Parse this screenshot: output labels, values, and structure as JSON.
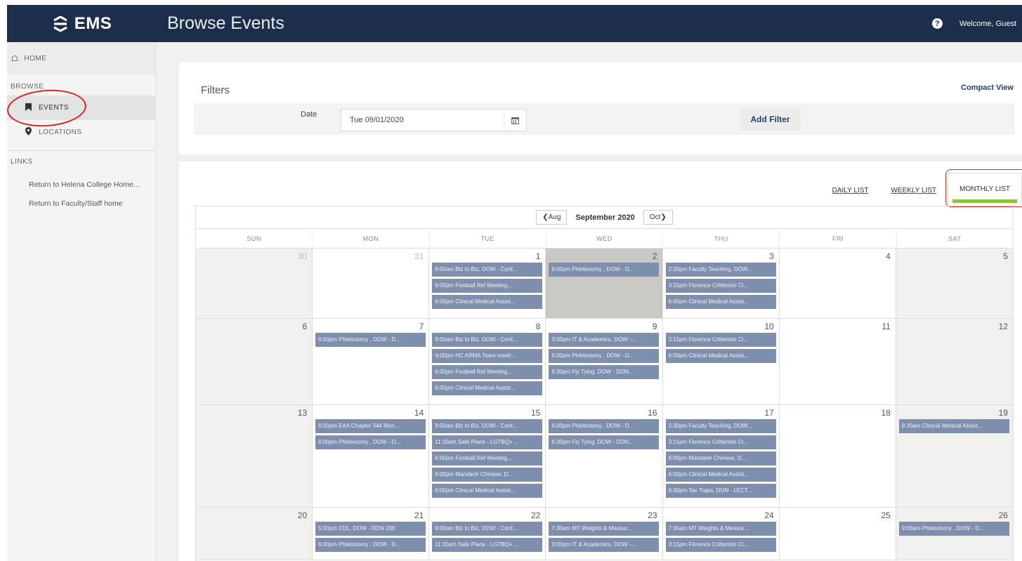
{
  "app": {
    "brand": "EMS",
    "page_title": "Browse Events",
    "help": "?",
    "welcome": "Welcome, Guest"
  },
  "sidebar": {
    "home": "HOME",
    "browse_label": "BROWSE",
    "items": [
      {
        "label": "EVENTS",
        "icon": "bookmark-icon"
      },
      {
        "label": "LOCATIONS",
        "icon": "map-pin-icon"
      }
    ],
    "links_label": "LINKS",
    "links": [
      "Return to Helena College Home...",
      "Return to Faculty/Staff home"
    ]
  },
  "filters": {
    "title": "Filters",
    "compact_view": "Compact View",
    "date_label": "Date",
    "date_value": "Tue 09/01/2020",
    "add_filter": "Add Filter"
  },
  "views": {
    "daily": "DAILY LIST",
    "weekly": "WEEKLY LIST",
    "monthly": "MONTHLY LIST"
  },
  "calendar": {
    "prev": "Aug",
    "next": "Oct",
    "title": "September 2020",
    "dow": [
      "SUN",
      "MON",
      "TUE",
      "WED",
      "THU",
      "FRI",
      "SAT"
    ],
    "weeks": [
      [
        {
          "day": "30",
          "out": true,
          "events": []
        },
        {
          "day": "31",
          "out": true,
          "events": []
        },
        {
          "day": "1",
          "events": [
            "9:00am Biz to Biz, DOW - Conf...",
            "6:00pm Football Ref Meeting,...",
            "6:00pm Clinical Medical Assist..."
          ]
        },
        {
          "day": "2",
          "today": true,
          "events": [
            "6:00pm Phlebotomy , DOW - D..."
          ]
        },
        {
          "day": "3",
          "events": [
            "2:30pm Faculty Teaching, DOW...",
            "3:15pm Florence Crittenton Cl...",
            "6:00pm Clinical Medical Assist..."
          ]
        },
        {
          "day": "4",
          "events": []
        },
        {
          "day": "5",
          "events": []
        }
      ],
      [
        {
          "day": "6",
          "events": []
        },
        {
          "day": "7",
          "events": [
            "6:00pm Phlebotomy , DOW - D..."
          ]
        },
        {
          "day": "8",
          "events": [
            "9:00am Biz to Biz, DOW - Conf...",
            "4:00pm HC ARMA Team meeti...",
            "6:00pm Football Ref Meeting,...",
            "6:00pm Clinical Medical Assist..."
          ]
        },
        {
          "day": "9",
          "events": [
            "3:00pm IT & Academics, DOW -...",
            "6:00pm Phlebotomy , DOW - D...",
            "6:30pm Fly Tying, DOW - DON..."
          ]
        },
        {
          "day": "10",
          "events": [
            "3:15pm Florence Crittenton Cl...",
            "6:00pm Clinical Medical Assist..."
          ]
        },
        {
          "day": "11",
          "events": []
        },
        {
          "day": "12",
          "events": []
        }
      ],
      [
        {
          "day": "13",
          "events": []
        },
        {
          "day": "14",
          "events": [
            "6:00pm EAA Chapter 344 Mon...",
            "6:00pm Phlebotomy , DOW - D..."
          ]
        },
        {
          "day": "15",
          "events": [
            "9:00am Biz to Biz, DOW - Conf...",
            "11:30am Safe Place - LGTBQ+ ...",
            "6:00pm Football Ref Meeting,...",
            "6:00pm Mandarin Chinese, D...",
            "6:00pm Clinical Medical Assist..."
          ]
        },
        {
          "day": "16",
          "events": [
            "6:00pm Phlebotomy , DOW - D...",
            "6:30pm Fly Tying, DOW - DON..."
          ]
        },
        {
          "day": "17",
          "events": [
            "2:30pm Faculty Teaching, DOW...",
            "3:15pm Florence Crittenton Cl...",
            "6:00pm Mandarin Chinese, D...",
            "6:00pm Clinical Medical Assist...",
            "6:30pm Tax Traps, DON - LECT..."
          ]
        },
        {
          "day": "18",
          "events": []
        },
        {
          "day": "19",
          "events": [
            "8:30am Clinical Medical Assist..."
          ]
        }
      ],
      [
        {
          "day": "20",
          "events": []
        },
        {
          "day": "21",
          "events": [
            "5:00pm CDL, DOW - DON 206",
            "6:00pm Phlebotomy , DOW - D..."
          ]
        },
        {
          "day": "22",
          "events": [
            "9:00am Biz to Biz, DOW - Conf...",
            "11:30am Safe Place - LGTBQ+ ..."
          ]
        },
        {
          "day": "23",
          "events": [
            "7:30am MT Weights & Measur...",
            "3:00pm IT & Academics, DOW -..."
          ]
        },
        {
          "day": "24",
          "events": [
            "7:30am MT Weights & Measur...",
            "3:15pm Florence Crittenton Cl..."
          ]
        },
        {
          "day": "25",
          "events": []
        },
        {
          "day": "26",
          "events": [
            "9:00am Phlebotomy , DOW - D..."
          ]
        }
      ]
    ]
  }
}
